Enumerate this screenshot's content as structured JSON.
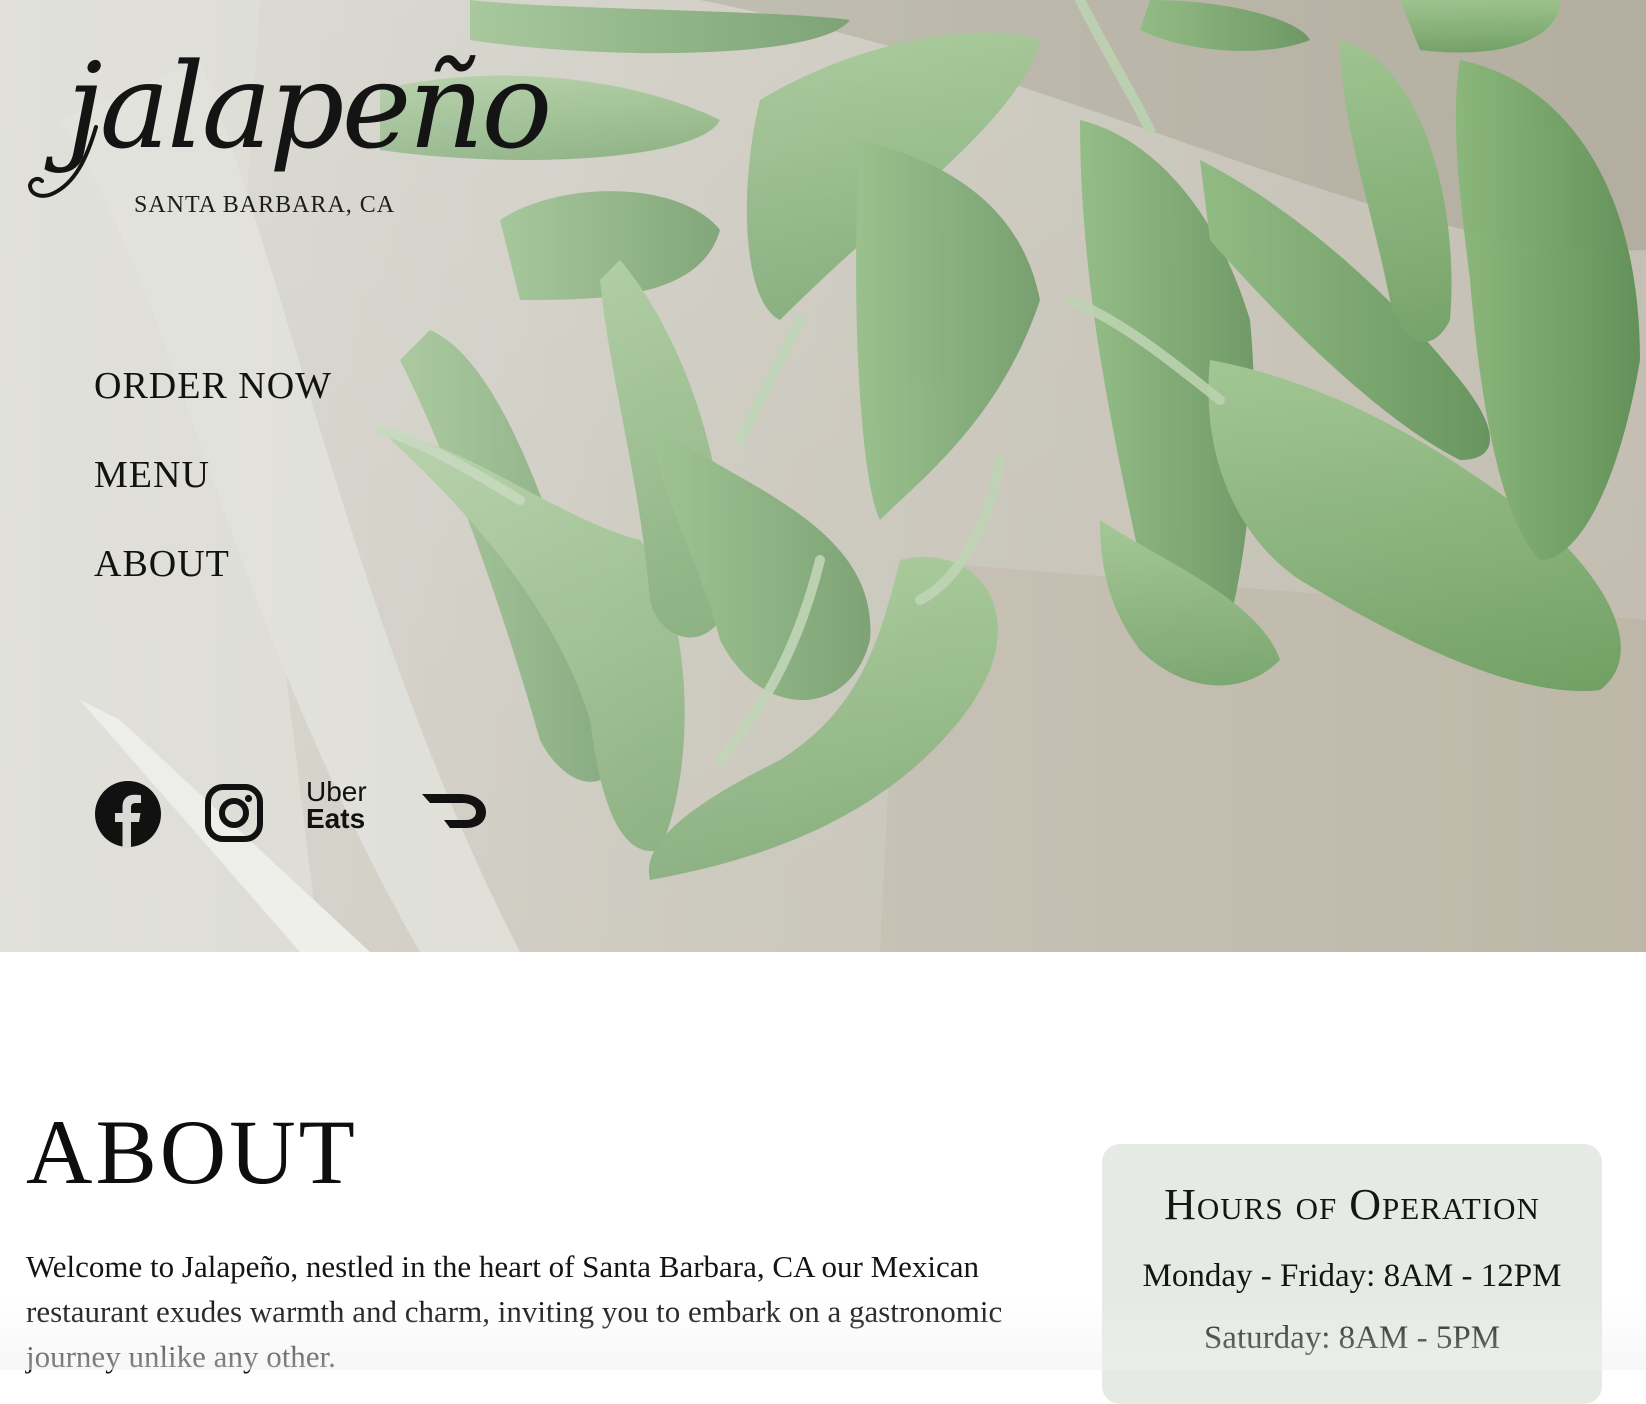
{
  "hero": {
    "logo_text": "jalapeño",
    "location": "SANTA BARBARA, CA",
    "nav": [
      {
        "label": "ORDER NOW"
      },
      {
        "label": "MENU"
      },
      {
        "label": "ABOUT"
      }
    ],
    "social_icons": [
      "facebook-icon",
      "instagram-icon",
      "uber-eats-icon",
      "doordash-icon"
    ],
    "uber_eats_line1": "Uber",
    "uber_eats_line2": "Eats"
  },
  "about": {
    "title": "ABOUT",
    "body": "Welcome to Jalapeño, nestled in the heart of Santa Barbara, CA our Mexican restaurant exudes warmth and charm, inviting you to embark on a gastronomic journey unlike any other."
  },
  "hours": {
    "title": "Hours of Operation",
    "lines": [
      "Monday - Friday: 8AM - 12PM",
      "Saturday: 8AM - 5PM"
    ]
  },
  "colors": {
    "hours_card_bg": "#e5ebe4",
    "text": "#111111",
    "pepper_green": "#5f9a4d"
  }
}
